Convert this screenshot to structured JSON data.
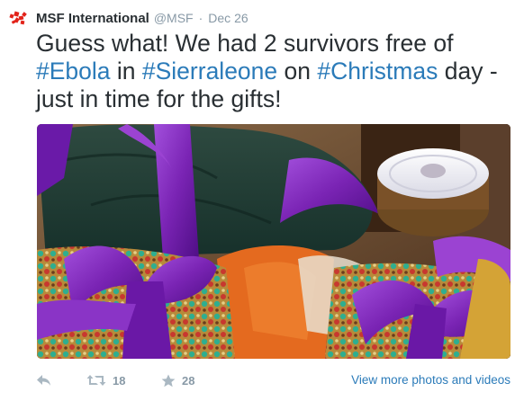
{
  "tweet": {
    "author_name": "MSF International",
    "author_handle": "@MSF",
    "separator": "·",
    "timestamp": "Dec 26",
    "text_parts": [
      {
        "text": "Guess what! We had 2 survivors free of ",
        "hashtag": false
      },
      {
        "text": "#Ebola",
        "hashtag": true
      },
      {
        "text": " in ",
        "hashtag": false
      },
      {
        "text": "#Sierraleone",
        "hashtag": true
      },
      {
        "text": " on ",
        "hashtag": false
      },
      {
        "text": "#Christmas",
        "hashtag": true
      },
      {
        "text": " day - just in time for the gifts!",
        "hashtag": false
      }
    ]
  },
  "media": {
    "icon": "photo-of-wrapped-gifts"
  },
  "actions": {
    "reply_icon": "reply-icon",
    "retweet_icon": "retweet-icon",
    "retweet_count": "18",
    "favorite_icon": "star-icon",
    "favorite_count": "28",
    "view_more_label": "View more photos and videos"
  },
  "colors": {
    "text": "#292f33",
    "muted": "#8899a6",
    "link": "#2b7bb9",
    "msf_red": "#e2231a"
  }
}
